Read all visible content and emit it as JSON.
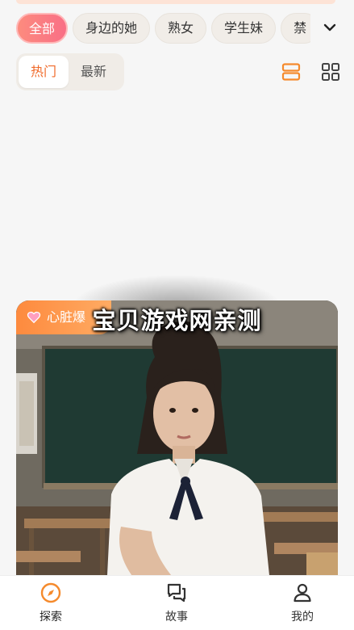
{
  "categories": {
    "items": [
      "全部",
      "身边的她",
      "熟女",
      "学生妹",
      "禁"
    ],
    "active_index": 0
  },
  "sort_tabs": {
    "hot": "热门",
    "latest": "最新"
  },
  "card": {
    "tag_label": "心脏爆",
    "tag_icon": "heart-icon",
    "image_alt": "girl-in-classroom-photo"
  },
  "watermark": "宝贝游戏网亲测",
  "bottom_nav": {
    "explore": "探索",
    "story": "故事",
    "mine": "我的"
  },
  "colors": {
    "accent": "#f06a2a",
    "chip_active_start": "#fc8b7e",
    "chip_active_end": "#f96f86",
    "tag_gradient_start": "#fd8a3e",
    "tag_gradient_end": "#ffab63"
  },
  "icons": {
    "expand": "chevron-down-icon",
    "list_view": "list-view-icon",
    "grid_view": "grid-view-icon",
    "explore": "compass-icon",
    "story": "chat-bubbles-icon",
    "mine": "person-icon"
  }
}
